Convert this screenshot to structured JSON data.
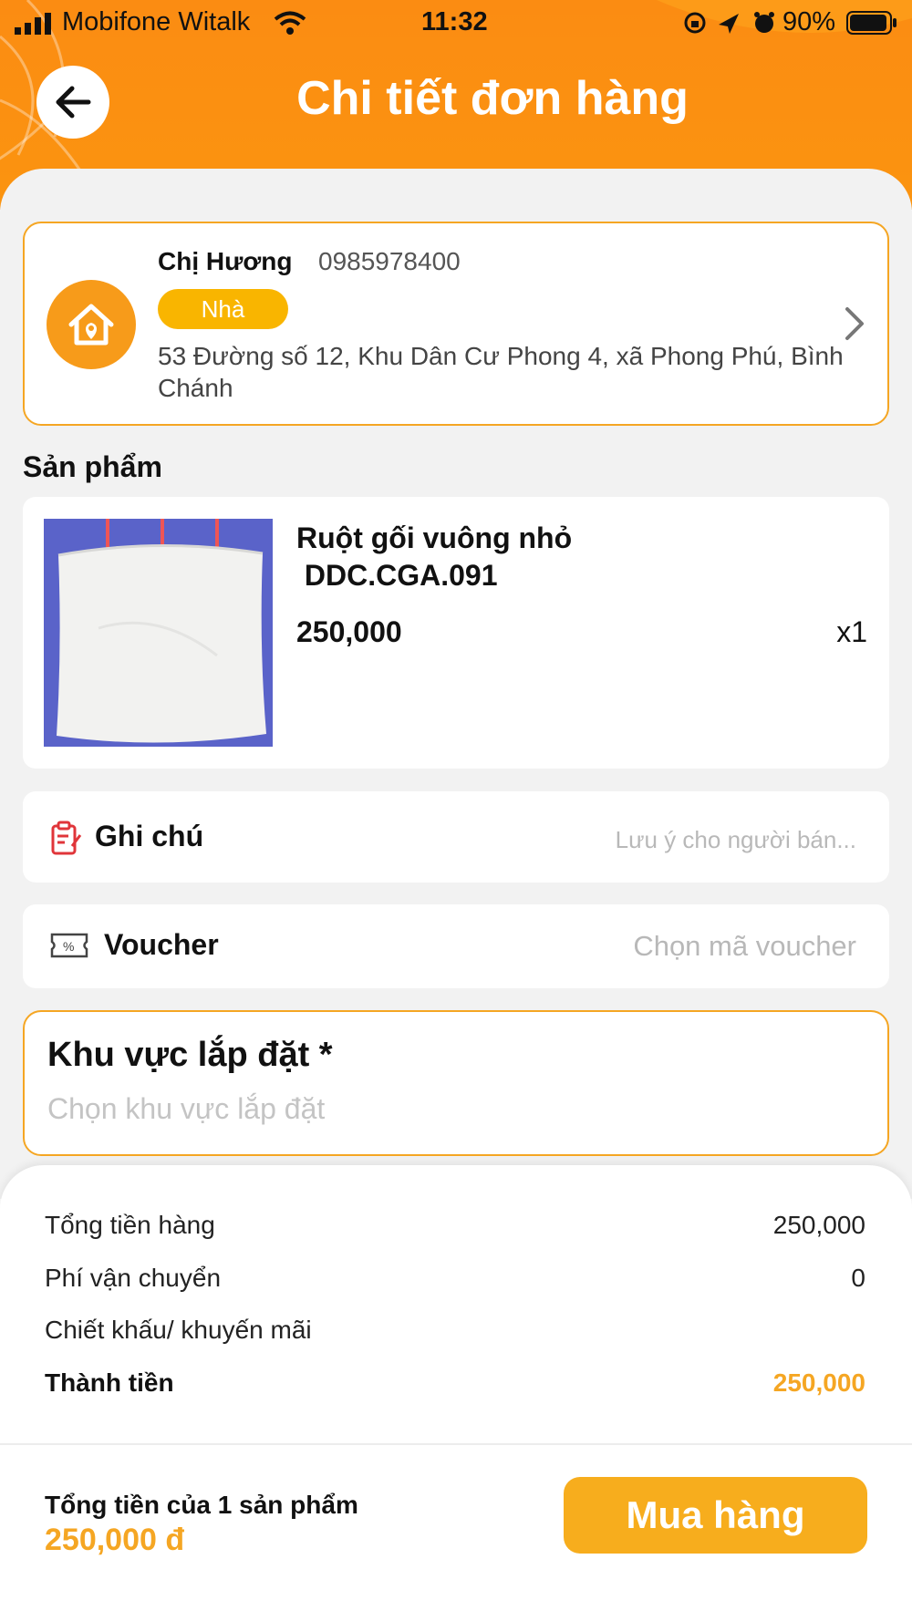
{
  "status_bar": {
    "carrier": "Mobifone Witalk",
    "time": "11:32",
    "battery": "90%"
  },
  "header": {
    "title": "Chi tiết đơn hàng",
    "back_icon": "arrow-left-icon"
  },
  "address": {
    "name": "Chị Hương",
    "phone": "0985978400",
    "badge": "Nhà",
    "line": "53 Đường số 12, Khu Dân Cư Phong 4, xã Phong Phú, Bình Chánh",
    "icon": "home-location-icon"
  },
  "products_section": {
    "title": "Sản phẩm",
    "items": [
      {
        "name": "Ruột gối vuông nhỏ\n DDC.CGA.091",
        "price": "250,000",
        "qty": "x1"
      }
    ]
  },
  "note": {
    "label": "Ghi chú",
    "placeholder": "Lưu ý cho người bán..."
  },
  "voucher": {
    "label": "Voucher",
    "placeholder": "Chọn mã voucher"
  },
  "install_area": {
    "title": "Khu vực lắp đặt *",
    "placeholder": "Chọn khu vực lắp đặt"
  },
  "summary": {
    "subtotal_label": "Tổng tiền hàng",
    "subtotal_value": "250,000",
    "shipping_label": "Phí vận chuyển",
    "shipping_value": "0",
    "discount_label": "Chiết khấu/ khuyến mãi",
    "total_label": "Thành tiền",
    "total_value": "250,000"
  },
  "footer": {
    "label": "Tổng tiền của 1 sản phẩm",
    "amount": "250,000 đ",
    "buy_label": "Mua hàng"
  },
  "colors": {
    "brand_orange": "#fb8c12",
    "accent_yellow": "#f5a623",
    "button": "#f7ad1d"
  }
}
